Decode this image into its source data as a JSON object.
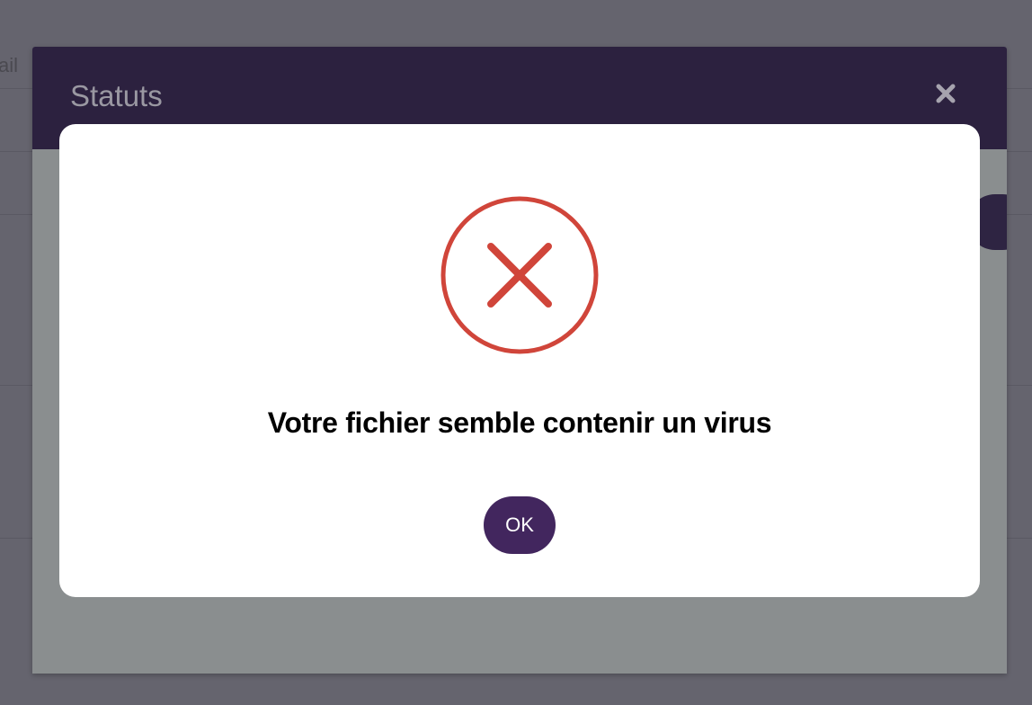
{
  "background": {
    "fragment_text": "ail"
  },
  "status_modal": {
    "title": "Statuts",
    "close_icon": "close-x-icon"
  },
  "alert": {
    "icon": "error-x-circle-icon",
    "icon_color": "#d0453a",
    "message": "Votre fichier semble contenir un virus",
    "ok_label": "OK",
    "ok_color": "#42265e"
  }
}
